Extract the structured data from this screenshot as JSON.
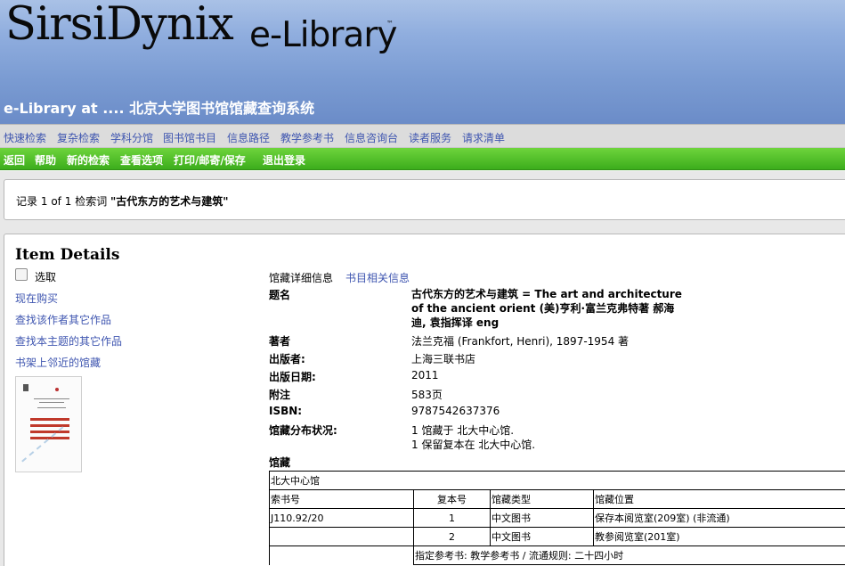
{
  "header": {
    "logo_main": "SirsiDynix",
    "logo_product": "e-Library",
    "logo_tm": "™",
    "site_title": "e-Library at .... 北京大学图书馆馆藏查询系统"
  },
  "nav_primary": [
    "快速检索",
    "复杂检索",
    "学科分馆",
    "图书馆书目",
    "信息路径",
    "教学参考书",
    "信息咨询台",
    "读者服务",
    "请求清单"
  ],
  "nav_secondary": [
    "返回",
    "帮助",
    "新的检索",
    "查看选项",
    "打印/邮寄/保存",
    "退出登录"
  ],
  "record": {
    "prefix": "记录",
    "position": "1",
    "of_label": "of",
    "total": "1",
    "query_label": "检索词",
    "query": "\"古代东方的艺术与建筑\""
  },
  "item_details": {
    "heading": "Item Details",
    "select_label": "选取",
    "links": [
      "现在购买",
      "查找该作者其它作品",
      "查找本主题的其它作品",
      "书架上邻近的馆藏"
    ]
  },
  "tabs": {
    "holdings": "馆藏详细信息",
    "bib": "书目相关信息"
  },
  "fields": {
    "title_label": "题名",
    "title_value": "古代东方的艺术与建筑 = The art and architecture of the ancient orient (美)亨利·富兰克弗特著 郝海迪, 袁指挥译 eng",
    "author_label": "著者",
    "author_value": "法兰克福 (Frankfort, Henri), 1897-1954 著",
    "publisher_label": "出版者:",
    "publisher_value": "上海三联书店",
    "date_label": "出版日期:",
    "date_value": "2011",
    "notes_label": "附注",
    "notes_value": "583页",
    "isbn_label": "ISBN:",
    "isbn_value": "9787542637376",
    "distribution_label": "馆藏分布状况:",
    "distribution_line1": "1 馆藏于 北大中心馆.",
    "distribution_line2": "1 保留复本在 北大中心馆.",
    "holdings_label": "馆藏"
  },
  "holdings": {
    "library": "北大中心馆",
    "columns": [
      "索书号",
      "复本号",
      "馆藏类型",
      "馆藏位置"
    ],
    "rows": [
      {
        "call_number": "J110.92/20",
        "copy": "1",
        "type": "中文图书",
        "location": "保存本阅览室(209室) (非流通)"
      },
      {
        "call_number": "",
        "copy": "2",
        "type": "中文图书",
        "location": "教参阅览室(201室)"
      }
    ],
    "footnote": "指定参考书: 教学参考书 / 流通规则: 二十四小时"
  },
  "colors": {
    "header_blue": "#7a9bd2",
    "nav_gray": "#dcdcdc",
    "nav_green": "#3cad1c",
    "link_blue": "#3f56b0"
  }
}
